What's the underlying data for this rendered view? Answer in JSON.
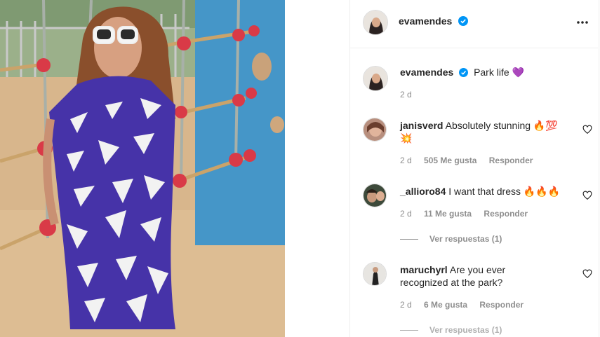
{
  "post": {
    "author": "evamendes",
    "caption": "Park life",
    "caption_emoji": "💜",
    "time": "2 d"
  },
  "comments": [
    {
      "user": "janisverd",
      "text": "Absolutely stunning 🔥💯💥",
      "time": "2 d",
      "likes": "505 Me gusta",
      "reply": "Responder"
    },
    {
      "user": "_allioro84",
      "text": "I want that dress 🔥🔥🔥",
      "time": "2 d",
      "likes": "11 Me gusta",
      "reply": "Responder",
      "view_replies": "Ver respuestas (1)"
    },
    {
      "user": "maruchyrl",
      "text_line1": "Are you ever",
      "text_line2": "recognized at the park?",
      "time": "2 d",
      "likes": "6 Me gusta",
      "reply": "Responder",
      "view_replies": "Ver respuestas (1)"
    }
  ],
  "icons": {
    "verified": "verified-badge-icon",
    "more": "more-options-icon",
    "like": "heart-outline-icon"
  },
  "colors": {
    "verified_blue": "#0095f6",
    "text": "#262626",
    "secondary": "#8e8e8e"
  }
}
